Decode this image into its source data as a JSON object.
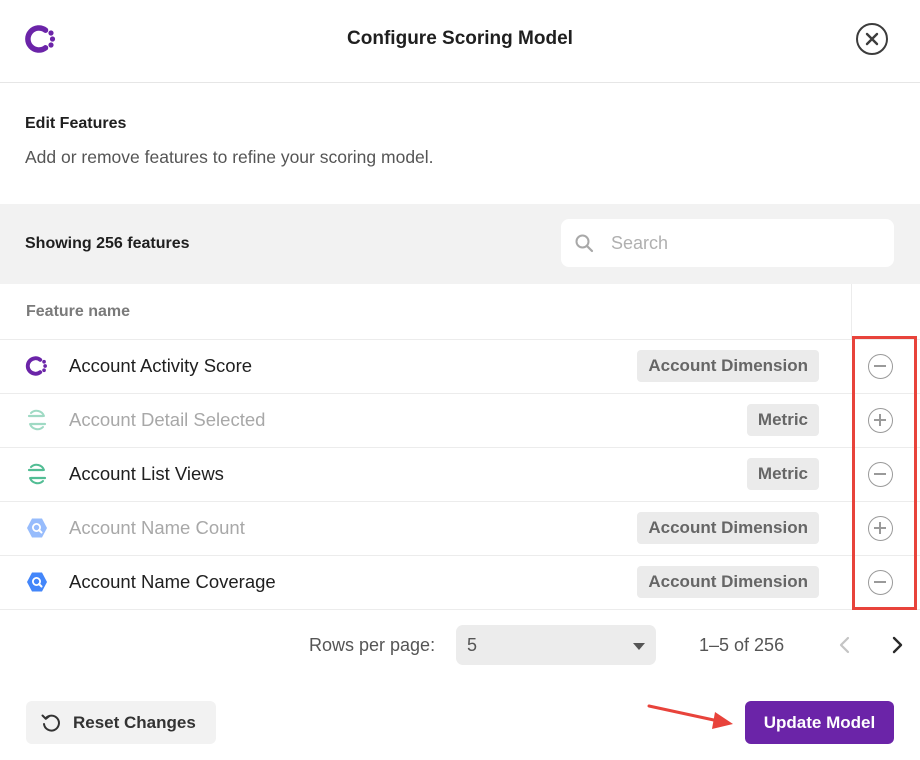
{
  "header": {
    "title": "Configure Scoring Model",
    "logo_icon": "brand-c-logo-icon",
    "close_icon": "close-circle-icon"
  },
  "section": {
    "title": "Edit Features",
    "subtitle": "Add or remove features to refine your scoring model."
  },
  "toolbar": {
    "showing_text": "Showing 256 features",
    "search_placeholder": "Search",
    "search_value": ""
  },
  "table": {
    "column_header": "Feature name",
    "rows": [
      {
        "name": "Account Activity Score",
        "badge": "Account Dimension",
        "source_icon": "brand-c-logo-icon",
        "included": true,
        "action": "remove"
      },
      {
        "name": "Account Detail Selected",
        "badge": "Metric",
        "source_icon": "segment-icon",
        "included": false,
        "action": "add"
      },
      {
        "name": "Account List Views",
        "badge": "Metric",
        "source_icon": "segment-icon",
        "included": true,
        "action": "remove"
      },
      {
        "name": "Account Name Count",
        "badge": "Account Dimension",
        "source_icon": "bigquery-icon",
        "included": false,
        "action": "add"
      },
      {
        "name": "Account Name Coverage",
        "badge": "Account Dimension",
        "source_icon": "bigquery-icon",
        "included": true,
        "action": "remove"
      }
    ]
  },
  "pagination": {
    "rows_per_page_label": "Rows per page:",
    "rows_per_page_value": "5",
    "range_text": "1–5 of 256"
  },
  "footer": {
    "reset_label": "Reset Changes",
    "update_label": "Update Model"
  },
  "colors": {
    "brand_purple": "#6b24a8",
    "annotation_red": "#e8433b",
    "segment_green": "#52bd94",
    "bigquery_blue": "#4386fa"
  }
}
